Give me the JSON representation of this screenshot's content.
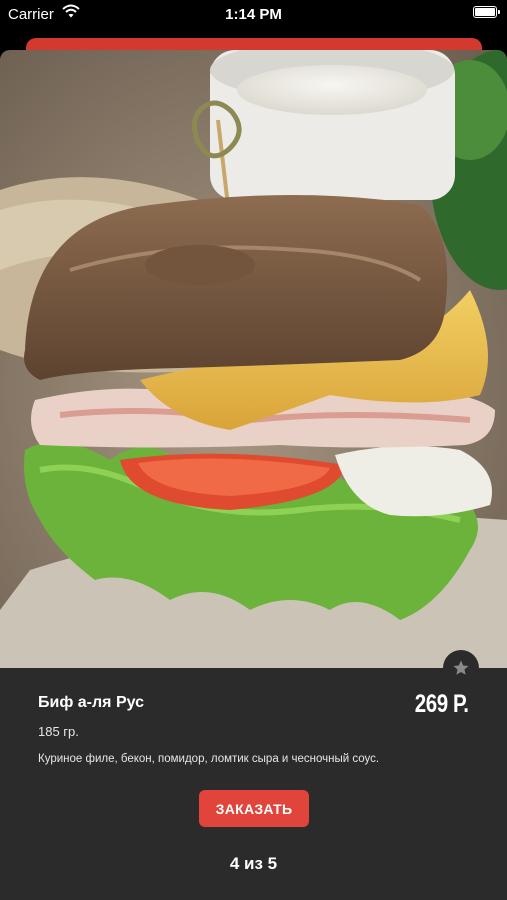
{
  "status_bar": {
    "carrier": "Carrier",
    "time": "1:14 PM",
    "icons": [
      "wifi-icon",
      "battery-icon"
    ]
  },
  "product": {
    "image_icon": "sandwich-photo",
    "name": "Биф а-ля Рус",
    "price": "269 Р.",
    "weight": "185 гр.",
    "description": "Куриное филе, бекон, помидор, ломтик сыра и чесночный соус.",
    "favorite_icon": "star-icon"
  },
  "order_button": {
    "label": "ЗАКАЗАТЬ"
  },
  "pager": {
    "label": "4 из 5"
  },
  "colors": {
    "accent": "#e0443a",
    "panel": "#2b2b2b",
    "background": "#000000"
  }
}
